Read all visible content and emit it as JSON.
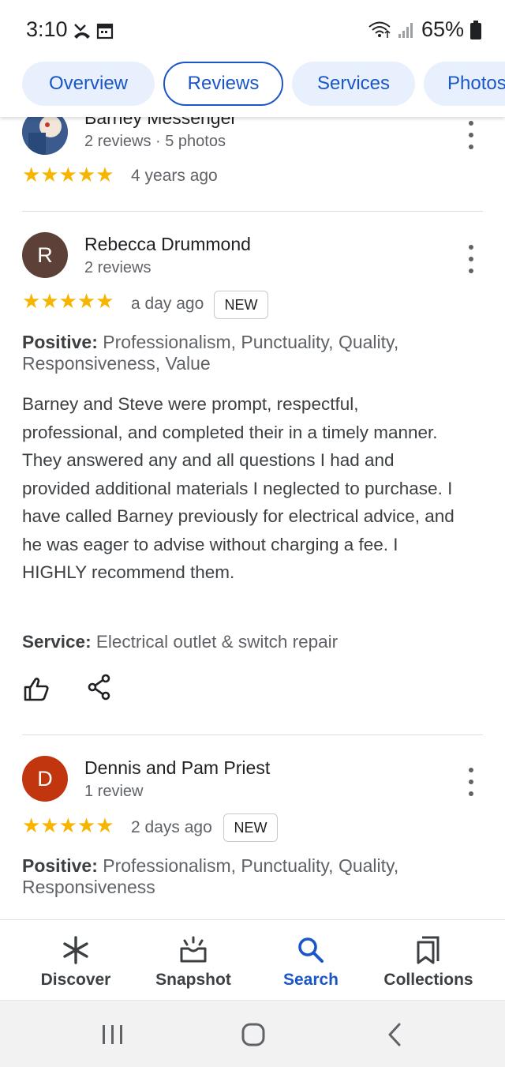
{
  "status_bar": {
    "time": "3:10",
    "battery": "65%"
  },
  "tabs": [
    {
      "label": "Overview",
      "active": false
    },
    {
      "label": "Reviews",
      "active": true
    },
    {
      "label": "Services",
      "active": false
    },
    {
      "label": "Photos",
      "active": false
    }
  ],
  "reviews": [
    {
      "name": "Barney Messenger",
      "meta": "2 reviews · 5 photos",
      "stars": "★★★★★",
      "time": "4 years ago"
    },
    {
      "avatar_letter": "R",
      "avatar_color": "#5d4037",
      "name": "Rebecca Drummond",
      "meta": "2 reviews",
      "stars": "★★★★★",
      "time": "a day ago",
      "badge": "NEW",
      "positive_label": "Positive:",
      "positive_text": " Professionalism, Punctuality, Quality, Responsiveness, Value",
      "body": "Barney and Steve were prompt, respectful, professional, and completed their in a timely manner.  They answered any and all questions I had and provided additional materials I neglected to purchase.  I have called Barney previously for electrical advice, and he was eager to advise without charging a fee.  I HIGHLY recommend them.",
      "service_label": "Service:",
      "service_text": " Electrical outlet & switch repair"
    },
    {
      "avatar_letter": "D",
      "avatar_color": "#c1360f",
      "name": "Dennis and Pam Priest",
      "meta": "1 review",
      "stars": "★★★★★",
      "time": "2 days ago",
      "badge": "NEW",
      "positive_label": "Positive:",
      "positive_text": " Professionalism, Punctuality, Quality, Responsiveness"
    }
  ],
  "bottom_nav": [
    {
      "label": "Discover",
      "icon": "asterisk-icon"
    },
    {
      "label": "Snapshot",
      "icon": "snapshot-icon"
    },
    {
      "label": "Search",
      "icon": "search-icon",
      "active": true
    },
    {
      "label": "Collections",
      "icon": "collections-icon"
    }
  ],
  "colors": {
    "accent": "#1a56c8",
    "chip_bg": "#e8f0fe",
    "star": "#f6b500"
  }
}
